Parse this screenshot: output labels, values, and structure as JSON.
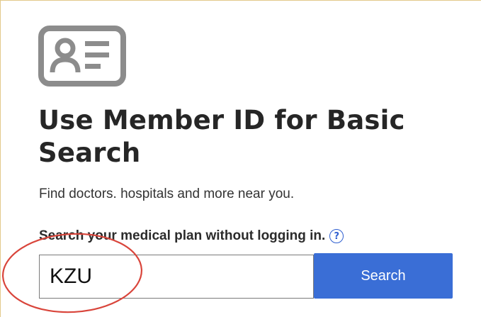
{
  "card": {
    "icon": "member-id-card-icon",
    "title": "Use Member ID for Basic Search",
    "subtitle": "Find doctors. hospitals and more near you.",
    "plan_label": "Search your medical plan without logging in.",
    "help_icon": "question-circle-icon",
    "help_glyph": "?"
  },
  "search": {
    "input_value": "KZU",
    "button_label": "Search"
  },
  "annotation": {
    "shape": "red-ellipse-highlight",
    "color": "#d9453b"
  },
  "colors": {
    "accent": "#3a6ed6",
    "title_text": "#262626",
    "icon_gray": "#8c8c8c",
    "card_border": "#e3c98a"
  }
}
